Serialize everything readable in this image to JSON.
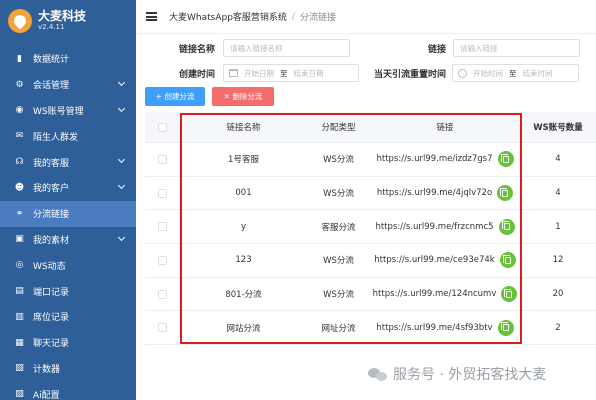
{
  "brand": {
    "name": "大麦科技",
    "version": "v2.4.11"
  },
  "sidebar": {
    "items": [
      {
        "label": "数据统计",
        "icon": "bar-chart-icon",
        "glyph": "▮",
        "chevron": false,
        "active": false
      },
      {
        "label": "会话管理",
        "icon": "chat-settings-icon",
        "glyph": "⚙",
        "chevron": true,
        "active": false
      },
      {
        "label": "WS账号管理",
        "icon": "account-icon",
        "glyph": "◉",
        "chevron": true,
        "active": false
      },
      {
        "label": "陌生人群发",
        "icon": "mail-icon",
        "glyph": "✉",
        "chevron": false,
        "active": false
      },
      {
        "label": "我的客服",
        "icon": "headset-icon",
        "glyph": "☊",
        "chevron": true,
        "active": false
      },
      {
        "label": "我的客户",
        "icon": "user-icon",
        "glyph": "☻",
        "chevron": true,
        "active": false
      },
      {
        "label": "分流链接",
        "icon": "link-icon",
        "glyph": "⚭",
        "chevron": false,
        "active": true
      },
      {
        "label": "我的素材",
        "icon": "image-icon",
        "glyph": "▣",
        "chevron": true,
        "active": false
      },
      {
        "label": "WS动态",
        "icon": "circle-icon",
        "glyph": "◎",
        "chevron": false,
        "active": false
      },
      {
        "label": "端口记录",
        "icon": "port-icon",
        "glyph": "▤",
        "chevron": false,
        "active": false
      },
      {
        "label": "席位记录",
        "icon": "seat-icon",
        "glyph": "▥",
        "chevron": false,
        "active": false
      },
      {
        "label": "聊天记录",
        "icon": "chat-log-icon",
        "glyph": "▦",
        "chevron": false,
        "active": false
      },
      {
        "label": "计数器",
        "icon": "counter-icon",
        "glyph": "▧",
        "chevron": false,
        "active": false
      },
      {
        "label": "Ai配置",
        "icon": "ai-config-icon",
        "glyph": "▨",
        "chevron": false,
        "active": false
      }
    ]
  },
  "header": {
    "system": "大麦WhatsApp客服营销系统",
    "separator": "/",
    "current": "分流链接"
  },
  "filters": {
    "link_name_label": "链接名称",
    "link_name_placeholder": "请输入链接名称",
    "link_label": "链接",
    "link_placeholder": "请输入链接",
    "created_label": "创建时间",
    "start_date": "开始日期",
    "to": "至",
    "end_date": "结束日期",
    "reset_label": "当天引流重置时间",
    "start_time": "开始时间",
    "end_time": "结束时间"
  },
  "toolbar": {
    "add_label": "+ 创建分流",
    "delete_label": "✕ 删除分流"
  },
  "table": {
    "headers": {
      "name": "链接名称",
      "type": "分配类型",
      "link": "链接",
      "count": "WS账号数量"
    },
    "rows": [
      {
        "name": "1号客服",
        "type": "WS分流",
        "link": "https://s.url99.me/izdz7gs7",
        "count": "4"
      },
      {
        "name": "001",
        "type": "WS分流",
        "link": "https://s.url99.me/4jqlv72o",
        "count": "4"
      },
      {
        "name": "y",
        "type": "客服分流",
        "link": "https://s.url99.me/frzcnmc5",
        "count": "1"
      },
      {
        "name": "123",
        "type": "WS分流",
        "link": "https://s.url99.me/ce93e74k",
        "count": "12"
      },
      {
        "name": "801-分流",
        "type": "WS分流",
        "link": "https://s.url99.me/124ncumv",
        "count": "20"
      },
      {
        "name": "网站分流",
        "type": "网址分流",
        "link": "https://s.url99.me/4sf93btv",
        "count": "2"
      }
    ]
  },
  "watermark": "服务号 · 外贸拓客找大麦",
  "colors": {
    "sidebar": "#2f5f99",
    "active": "#4b7cc0",
    "primary": "#409eff",
    "danger": "#f56c6c",
    "success": "#67c23a",
    "highlight": "#e0191f"
  }
}
